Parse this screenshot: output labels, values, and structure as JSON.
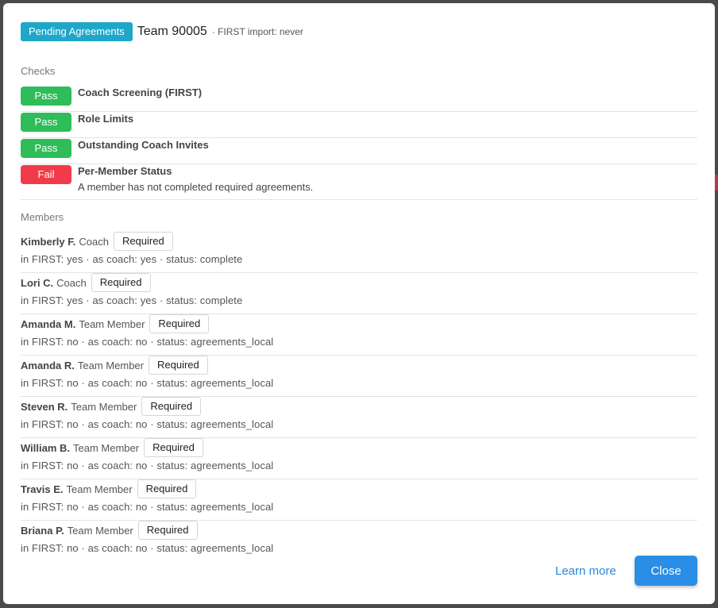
{
  "header": {
    "status_badge": "Pending Agreements",
    "team_title": "Team 90005",
    "import_note": "· FIRST import: never"
  },
  "checks_label": "Checks",
  "checks": [
    {
      "status": "Pass",
      "title": "Coach Screening (FIRST)",
      "description": ""
    },
    {
      "status": "Pass",
      "title": "Role Limits",
      "description": ""
    },
    {
      "status": "Pass",
      "title": "Outstanding Coach Invites",
      "description": ""
    },
    {
      "status": "Fail",
      "title": "Per-Member Status",
      "description": "A member has not completed required agreements."
    }
  ],
  "members_label": "Members",
  "members": [
    {
      "name": "Kimberly F.",
      "role": "Coach",
      "badge": "Required",
      "detail": "in FIRST: yes · as coach: yes · status: complete"
    },
    {
      "name": "Lori C.",
      "role": "Coach",
      "badge": "Required",
      "detail": "in FIRST: yes · as coach: yes · status: complete"
    },
    {
      "name": "Amanda M.",
      "role": "Team Member",
      "badge": "Required",
      "detail": "in FIRST: no · as coach: no · status: agreements_local"
    },
    {
      "name": "Amanda R.",
      "role": "Team Member",
      "badge": "Required",
      "detail": "in FIRST: no · as coach: no · status: agreements_local"
    },
    {
      "name": "Steven R.",
      "role": "Team Member",
      "badge": "Required",
      "detail": "in FIRST: no · as coach: no · status: agreements_local"
    },
    {
      "name": "William B.",
      "role": "Team Member",
      "badge": "Required",
      "detail": "in FIRST: no · as coach: no · status: agreements_local"
    },
    {
      "name": "Travis E.",
      "role": "Team Member",
      "badge": "Required",
      "detail": "in FIRST: no · as coach: no · status: agreements_local"
    },
    {
      "name": "Briana P.",
      "role": "Team Member",
      "badge": "Required",
      "detail": "in FIRST: no · as coach: no · status: agreements_local"
    }
  ],
  "footer": {
    "learn_more": "Learn more",
    "close": "Close"
  },
  "colors": {
    "pending_badge": "#1fa7c9",
    "pass": "#2ebd59",
    "fail": "#f23b4a",
    "primary": "#2a8ee6",
    "link": "#2a88d9"
  }
}
